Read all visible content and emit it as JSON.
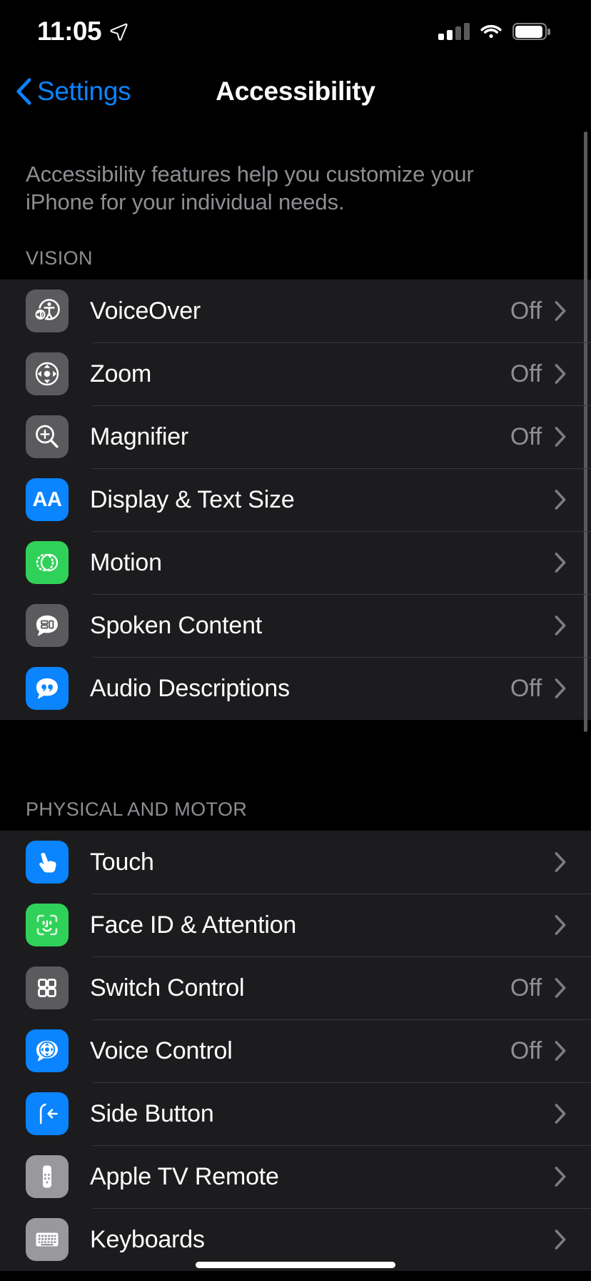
{
  "status_bar": {
    "time": "11:05",
    "location_icon": "location-arrow-icon",
    "signal_icon": "cellular-signal-icon",
    "signal_bars_filled": 2,
    "signal_bars_total": 4,
    "wifi_icon": "wifi-icon",
    "battery_icon": "battery-full-icon",
    "battery_level_percent": 100
  },
  "nav": {
    "back_label": "Settings",
    "back_icon": "chevron-left-icon",
    "title": "Accessibility"
  },
  "intro": {
    "text": "Accessibility features help you customize your iPhone for your individual needs."
  },
  "colors": {
    "accent_blue": "#0a84ff",
    "icon_blue": "#0a84ff",
    "icon_green": "#30d158",
    "icon_gray": "#5b5b5e",
    "icon_gray_light": "#98989d",
    "row_background": "#1c1c1e",
    "page_background": "#000000",
    "secondary_text": "#8e8e93",
    "separator": "#38383a"
  },
  "sections": [
    {
      "header": "VISION",
      "rows": [
        {
          "label": "VoiceOver",
          "value": "Off",
          "icon": "voiceover-icon",
          "icon_style": "gray"
        },
        {
          "label": "Zoom",
          "value": "Off",
          "icon": "zoom-icon",
          "icon_style": "gray"
        },
        {
          "label": "Magnifier",
          "value": "Off",
          "icon": "magnifier-icon",
          "icon_style": "gray"
        },
        {
          "label": "Display & Text Size",
          "value": "",
          "icon": "display-text-size-icon",
          "icon_style": "blue"
        },
        {
          "label": "Motion",
          "value": "",
          "icon": "motion-icon",
          "icon_style": "green"
        },
        {
          "label": "Spoken Content",
          "value": "",
          "icon": "spoken-content-icon",
          "icon_style": "gray"
        },
        {
          "label": "Audio Descriptions",
          "value": "Off",
          "icon": "audio-descriptions-icon",
          "icon_style": "blue"
        }
      ]
    },
    {
      "header": "PHYSICAL AND MOTOR",
      "rows": [
        {
          "label": "Touch",
          "value": "",
          "icon": "touch-icon",
          "icon_style": "blue"
        },
        {
          "label": "Face ID & Attention",
          "value": "",
          "icon": "face-id-icon",
          "icon_style": "green"
        },
        {
          "label": "Switch Control",
          "value": "Off",
          "icon": "switch-control-icon",
          "icon_style": "gray"
        },
        {
          "label": "Voice Control",
          "value": "Off",
          "icon": "voice-control-icon",
          "icon_style": "blue"
        },
        {
          "label": "Side Button",
          "value": "",
          "icon": "side-button-icon",
          "icon_style": "blue"
        },
        {
          "label": "Apple TV Remote",
          "value": "",
          "icon": "apple-tv-remote-icon",
          "icon_style": "gray-light"
        },
        {
          "label": "Keyboards",
          "value": "",
          "icon": "keyboards-icon",
          "icon_style": "gray-light"
        }
      ]
    }
  ],
  "home_indicator": "home-indicator"
}
